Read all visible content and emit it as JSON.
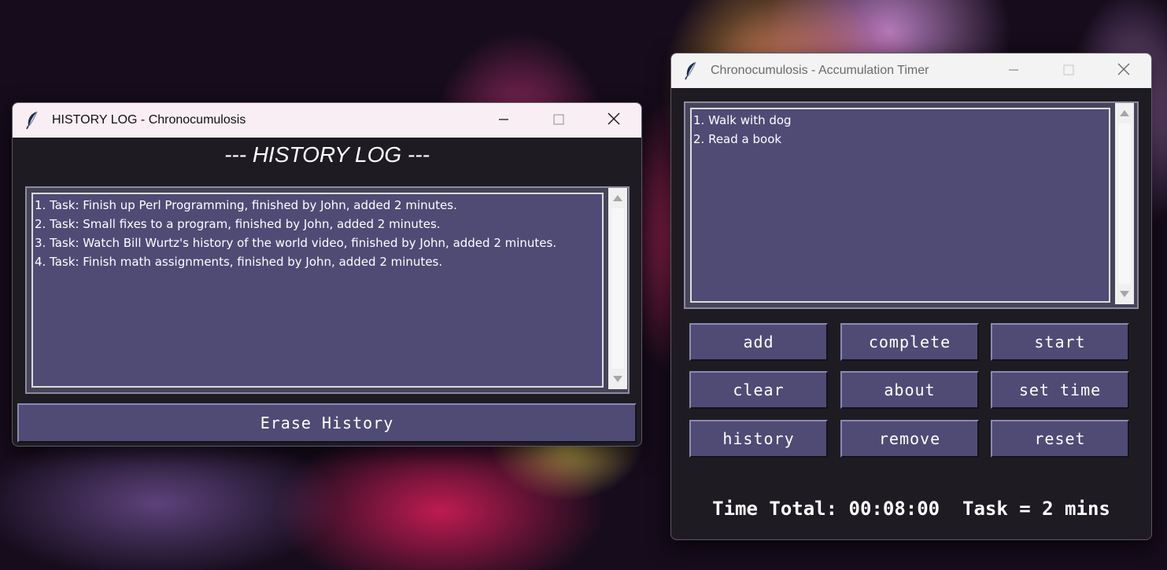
{
  "history_window": {
    "title": "HISTORY LOG - Chronocumulosis",
    "heading": "--- HISTORY LOG ---",
    "entries": [
      "1. Task: Finish up Perl Programming, finished by John, added 2 minutes.",
      "2. Task: Small fixes to a program, finished by John, added 2 minutes.",
      "3. Task: Watch Bill Wurtz's history of the world video, finished by John, added 2 minutes.",
      "4. Task: Finish math assignments, finished by John, added 2 minutes."
    ],
    "erase_button": "Erase History"
  },
  "timer_window": {
    "title": "Chronocumulosis - Accumulation Timer",
    "tasks": [
      "1. Walk with dog",
      "2. Read a book"
    ],
    "buttons": {
      "add": "add",
      "complete": "complete",
      "start": "start",
      "clear": "clear",
      "about": "about",
      "set_time": "set time",
      "history": "history",
      "remove": "remove",
      "reset": "reset"
    },
    "time_total": "Time Total: 00:08:00  Task = 2 mins"
  },
  "colors": {
    "window_bg": "#1e1c22",
    "list_bg": "#4f4b75",
    "button_bg": "#4f4b75",
    "text": "#ffffff"
  },
  "icons": [
    "feather-icon",
    "minimize-icon",
    "maximize-icon",
    "close-icon",
    "scroll-up-icon",
    "scroll-down-icon"
  ]
}
